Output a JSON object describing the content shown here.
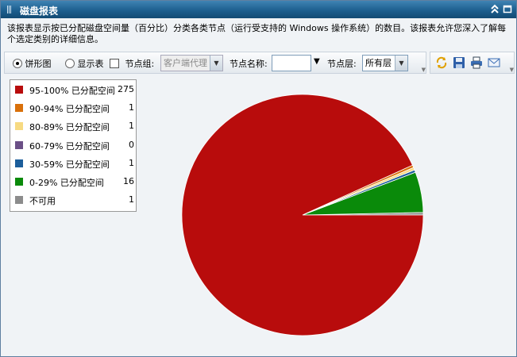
{
  "window": {
    "title": "磁盘报表"
  },
  "description": "该报表显示按已分配磁盘空间量（百分比）分类各类节点（运行受支持的 Windows 操作系统）的数目。该报表允许您深入了解每个选定类别的详细信息。",
  "toolbar": {
    "pie_label": "饼形图",
    "table_label": "显示表",
    "node_group_label": "节点组:",
    "node_group_value": "客户端代理",
    "node_name_label": "节点名称:",
    "node_name_value": "",
    "node_level_label": "节点层:",
    "node_level_value": "所有层"
  },
  "icons": [
    "refresh-icon",
    "save-icon",
    "print-icon",
    "email-icon"
  ],
  "colors": {
    "title_bar": "#1d5f8f"
  },
  "chart_data": {
    "type": "pie",
    "categories": [
      "95-100% 已分配空间",
      "90-94% 已分配空间",
      "80-89% 已分配空间",
      "60-79% 已分配空间",
      "30-59% 已分配空间",
      "0-29% 已分配空间",
      "不可用"
    ],
    "values": [
      275,
      1,
      1,
      0,
      1,
      16,
      1
    ],
    "colors": [
      "#b80c0c",
      "#d9700a",
      "#f7da82",
      "#6b4f86",
      "#1c5e9b",
      "#0a8a0a",
      "#8c8c8c"
    ]
  }
}
